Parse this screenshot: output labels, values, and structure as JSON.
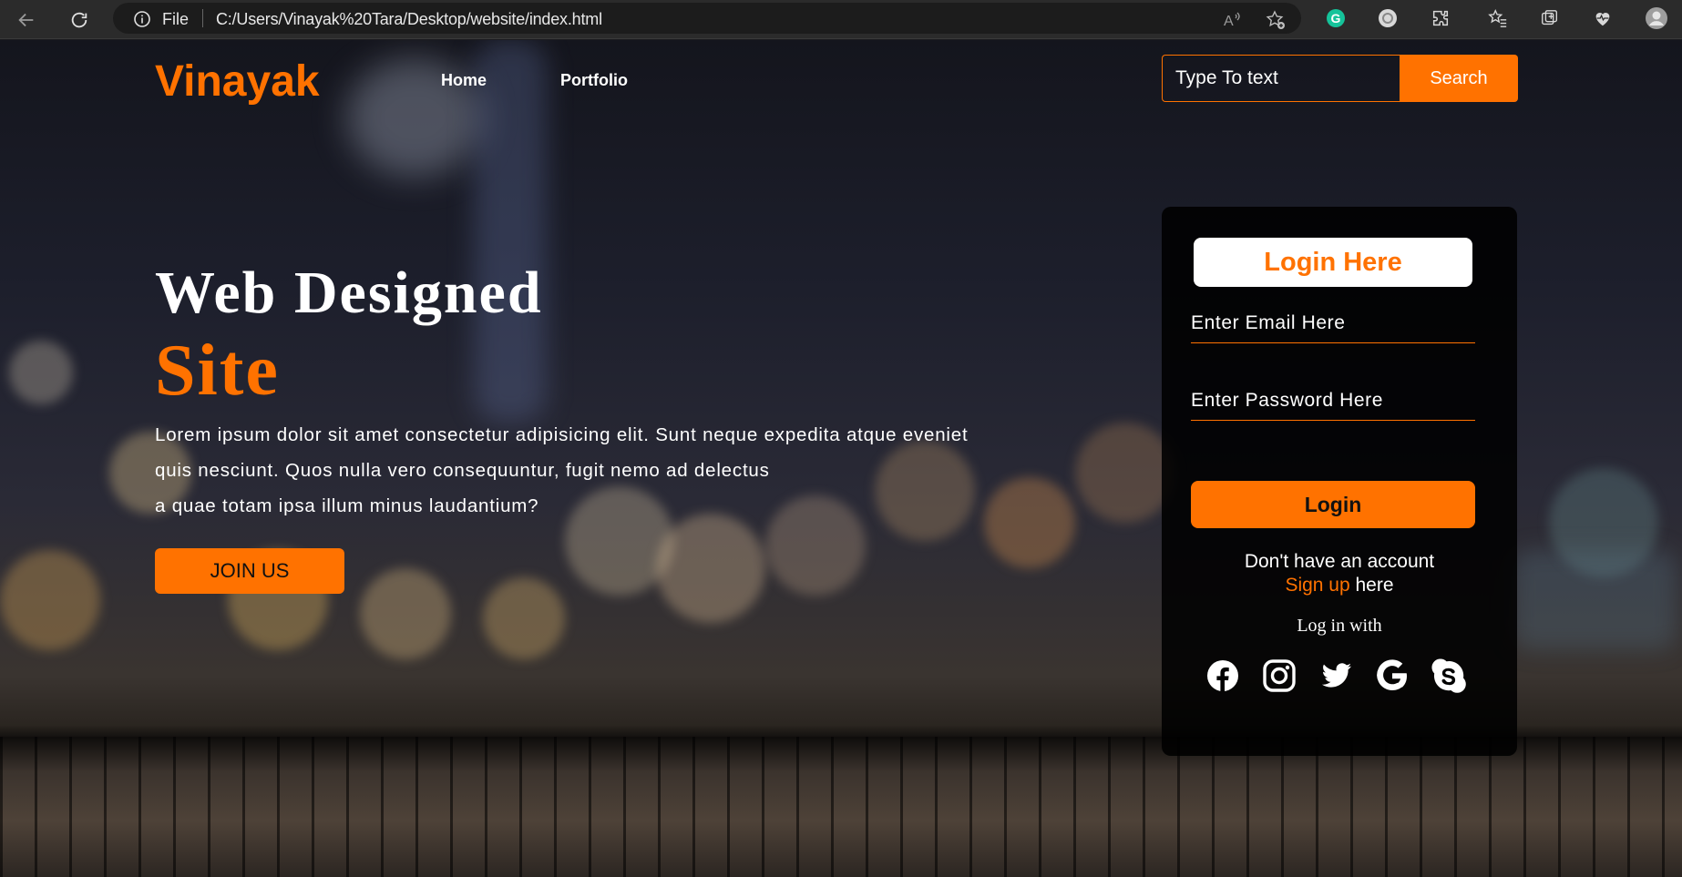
{
  "browser": {
    "file_label": "File",
    "url": "C:/Users/Vinayak%20Tara/Desktop/website/index.html",
    "extensions": [
      "grammarly-icon",
      "circle-extension-icon",
      "puzzle-icon",
      "favorites-icon",
      "collections-icon",
      "heart-pulse-icon",
      "profile-icon"
    ]
  },
  "navbar": {
    "logo": "Vinayak",
    "links": [
      "Home",
      "Portfolio"
    ],
    "search_placeholder": "Type To text",
    "search_button": "Search"
  },
  "hero": {
    "title_line1": "Web Designed",
    "title_line2": "Site",
    "paragraph_lines": [
      "Lorem ipsum dolor sit amet consectetur adipisicing elit. Sunt neque expedita atque eveniet",
      "quis nesciunt. Quos nulla vero consequuntur, fugit nemo ad delectus",
      "a quae totam ipsa illum minus laudantium?"
    ],
    "join_button": "JOIN US"
  },
  "login_card": {
    "title": "Login Here",
    "email_placeholder": "Enter Email Here",
    "password_placeholder": "Enter Password Here",
    "login_button": "Login",
    "no_account": "Don't have an account",
    "signup_link": "Sign up",
    "signup_suffix": " here",
    "login_with": "Log in with",
    "social_icons": [
      "facebook-icon",
      "instagram-icon",
      "twitter-icon",
      "google-icon",
      "skype-icon"
    ]
  },
  "colors": {
    "accent": "#ff7200",
    "card_bg": "#000000",
    "text": "#ffffff"
  }
}
